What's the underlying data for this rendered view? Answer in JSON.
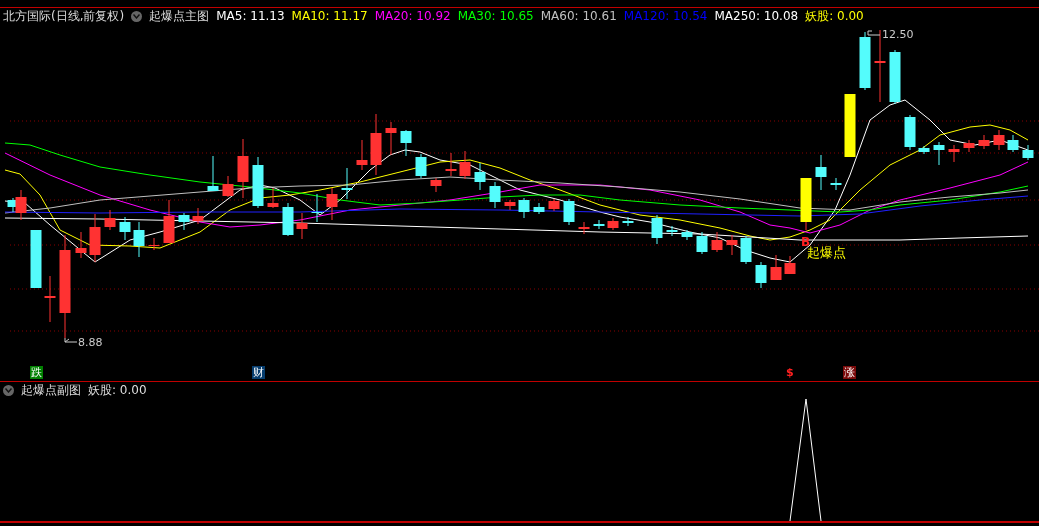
{
  "header": {
    "title": "北方国际(日线,前复权)",
    "indicator": "起爆点主图",
    "values": [
      {
        "text": "MA5: 11.13",
        "color": "#ffffff"
      },
      {
        "text": "MA10: 11.17",
        "color": "#ffff00"
      },
      {
        "text": "MA20: 10.92",
        "color": "#ff00ff"
      },
      {
        "text": "MA30: 10.65",
        "color": "#00ff00"
      },
      {
        "text": "MA60: 10.61",
        "color": "#c0c0c0"
      },
      {
        "text": "MA120: 10.54",
        "color": "#0000ff"
      },
      {
        "text": "MA250: 10.08",
        "color": "#ffffff"
      },
      {
        "text": "妖股: 0.00",
        "color": "#ffff00"
      }
    ]
  },
  "main_chart": {
    "high_label": "12.50",
    "low_label": "8.88",
    "signal_mark": "B",
    "signal_label": "起爆点"
  },
  "event_markers": [
    {
      "text": "跌",
      "kind": "fall"
    },
    {
      "text": "财",
      "kind": "finance"
    },
    {
      "text": "$",
      "kind": "dollar"
    },
    {
      "text": "涨",
      "kind": "rise"
    }
  ],
  "sub_chart": {
    "indicator": "起爆点副图",
    "values": [
      {
        "text": "妖股: 0.00"
      }
    ]
  }
}
